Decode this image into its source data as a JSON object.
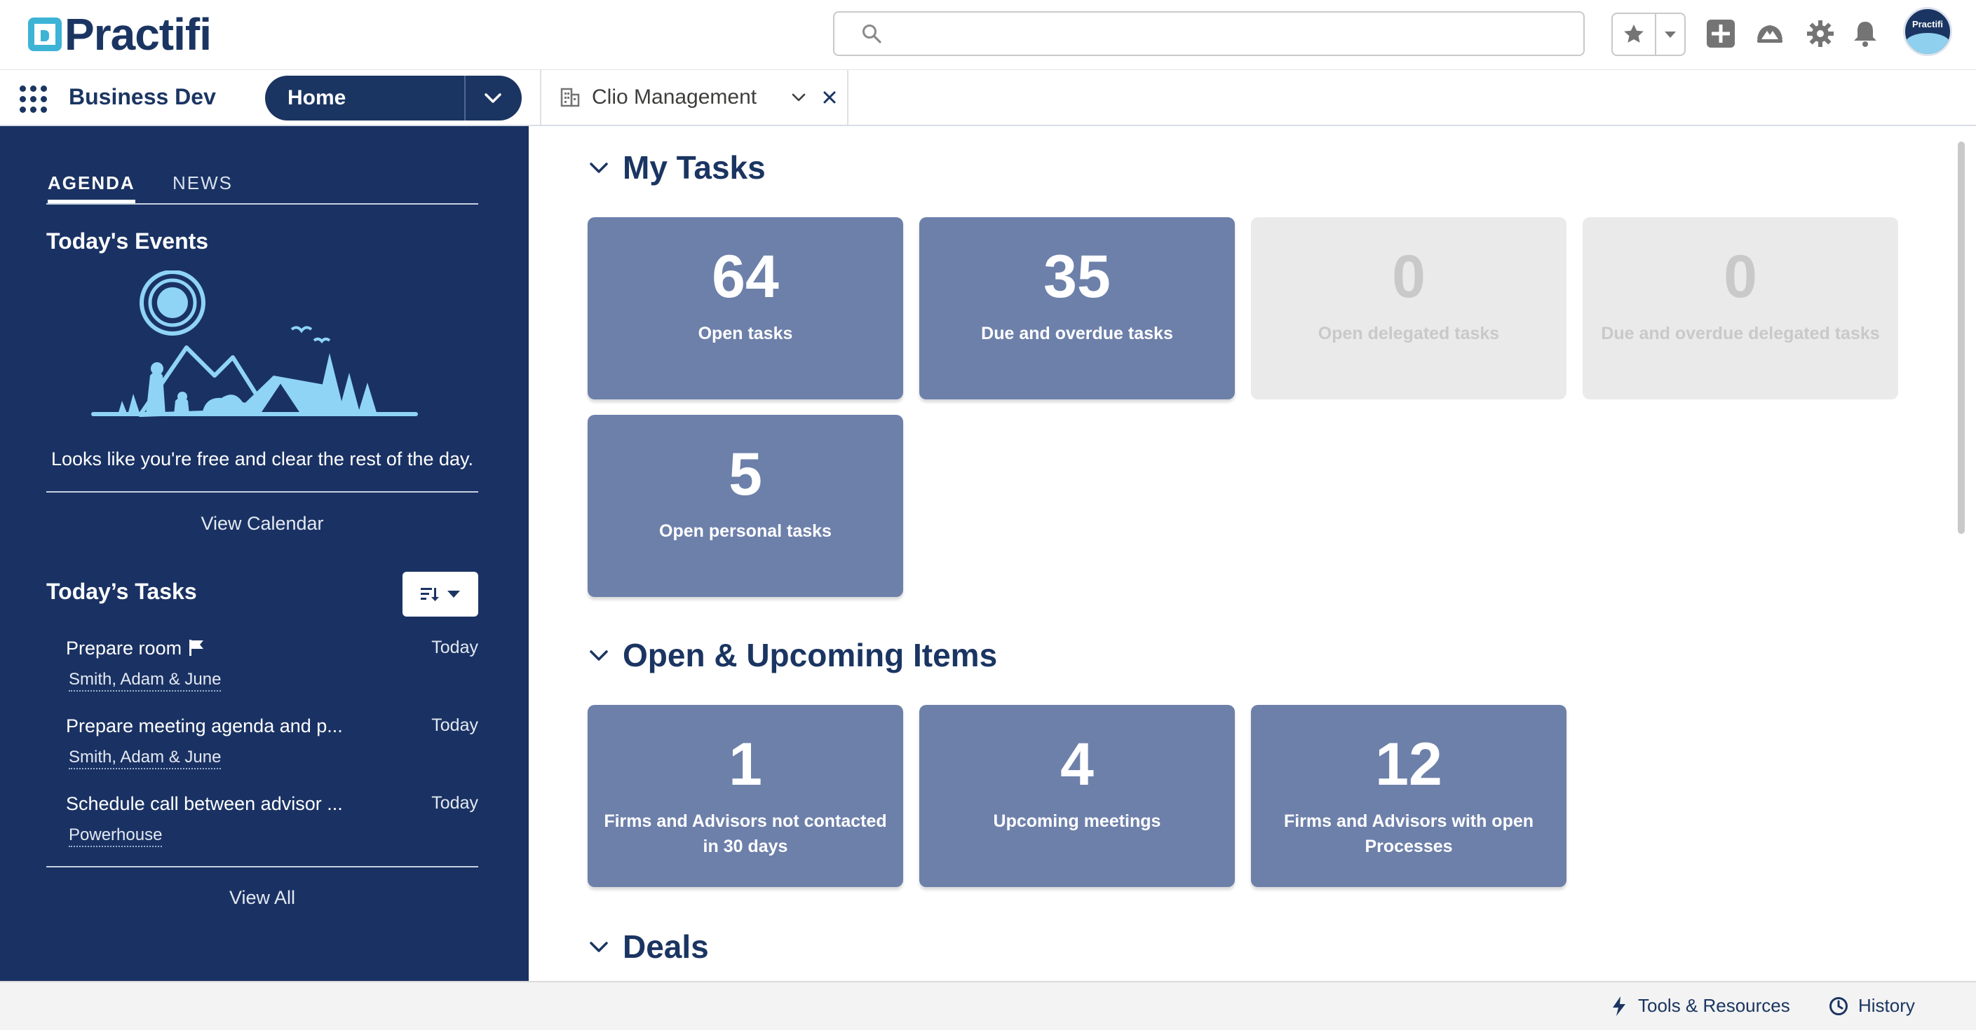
{
  "header": {
    "logo_text": "Practifi",
    "search": {
      "value": "",
      "placeholder": ""
    },
    "icons": [
      "search-icon",
      "star-icon",
      "chevron-down-icon",
      "add-icon",
      "trailhead-icon",
      "gear-icon",
      "bell-icon",
      "avatar"
    ],
    "avatar_text": "Practifi"
  },
  "nav": {
    "app_name": "Business Dev",
    "home_label": "Home",
    "tab_label": "Clio Management"
  },
  "left_panel": {
    "tabs": [
      "AGENDA",
      "NEWS"
    ],
    "events_title": "Today's Events",
    "events_empty_message": "Looks like you're free and clear the rest of the day.",
    "view_calendar": "View Calendar",
    "tasks_title": "Today’s Tasks",
    "tasks": [
      {
        "title": "Prepare room",
        "date": "Today",
        "related": "Smith, Adam & June",
        "flag": true
      },
      {
        "title": "Prepare meeting agenda and p...",
        "date": "Today",
        "related": "Smith, Adam & June",
        "flag": false
      },
      {
        "title": "Schedule call between advisor ...",
        "date": "Today",
        "related": "Powerhouse",
        "flag": false
      }
    ],
    "view_all": "View All"
  },
  "main": {
    "sections": {
      "my_tasks": "My Tasks",
      "open_upcoming": "Open & Upcoming Items",
      "deals": "Deals"
    },
    "my_tasks_tiles": [
      {
        "value": "64",
        "label": "Open tasks",
        "disabled": false
      },
      {
        "value": "35",
        "label": "Due and overdue tasks",
        "disabled": false
      },
      {
        "value": "0",
        "label": "Open delegated tasks",
        "disabled": true
      },
      {
        "value": "0",
        "label": "Due and overdue delegated tasks",
        "disabled": true
      },
      {
        "value": "5",
        "label": "Open personal tasks",
        "disabled": false
      }
    ],
    "open_upcoming_tiles": [
      {
        "value": "1",
        "label": "Firms and Advisors not contacted in 30 days",
        "disabled": false
      },
      {
        "value": "4",
        "label": "Upcoming meetings",
        "disabled": false
      },
      {
        "value": "12",
        "label": "Firms and Advisors with open Processes",
        "disabled": false
      }
    ]
  },
  "utility_bar": {
    "tools": "Tools & Resources",
    "history": "History"
  },
  "colors": {
    "brand_navy": "#1b3562",
    "panel_navy": "#1a3263",
    "tile_blue": "#6d80aa",
    "tile_disabled": "#eaeaea",
    "logo_cyan": "#3db3d6"
  }
}
